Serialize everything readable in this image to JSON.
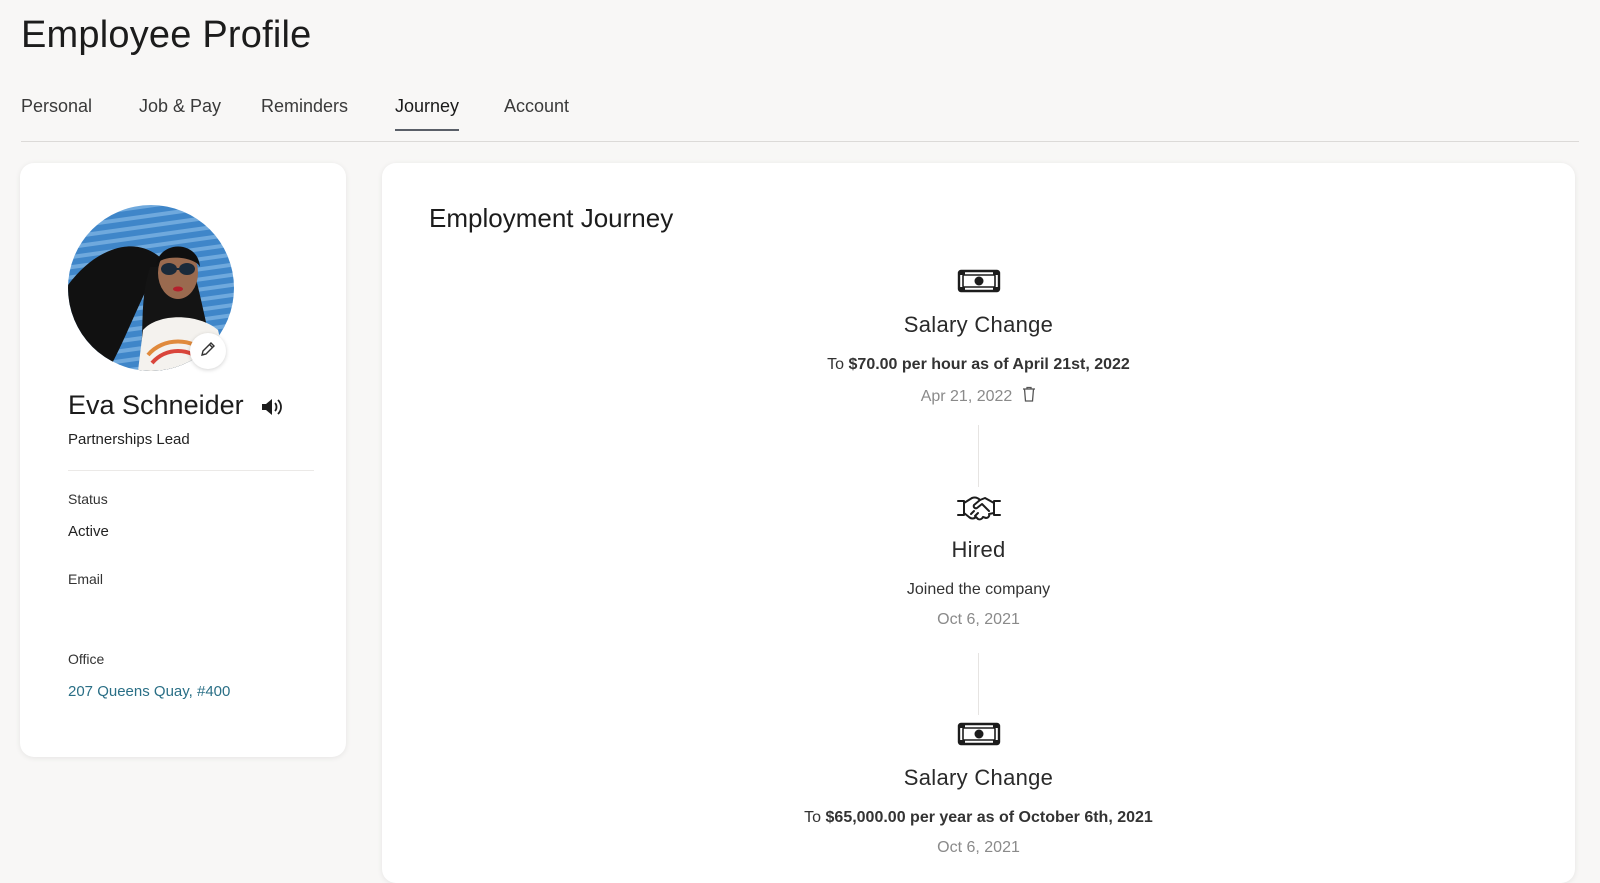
{
  "page": {
    "title": "Employee Profile"
  },
  "tabs": [
    {
      "label": "Personal"
    },
    {
      "label": "Job & Pay"
    },
    {
      "label": "Reminders"
    },
    {
      "label": "Journey",
      "active": true
    },
    {
      "label": "Account"
    }
  ],
  "profile": {
    "name": "Eva Schneider",
    "role": "Partnerships Lead",
    "status_label": "Status",
    "status_value": "Active",
    "email_label": "Email",
    "email_value": "",
    "office_label": "Office",
    "office_value": "207 Queens Quay, #400"
  },
  "journey": {
    "title": "Employment Journey",
    "events": [
      {
        "icon": "money-icon",
        "title": "Salary Change",
        "desc_prefix": "To ",
        "desc_bold": "$70.00 per hour as of April 21st, 2022",
        "date": "Apr 21, 2022",
        "deletable": true
      },
      {
        "icon": "handshake-icon",
        "title": "Hired",
        "desc_prefix": "Joined the company",
        "desc_bold": "",
        "date": "Oct 6, 2021",
        "deletable": false
      },
      {
        "icon": "money-icon",
        "title": "Salary Change",
        "desc_prefix": "To ",
        "desc_bold": "$65,000.00 per year as of October 6th, 2021",
        "date": "Oct 6, 2021",
        "deletable": false
      }
    ]
  },
  "colors": {
    "page_bg": "#f8f7f6",
    "link": "#2a6f86",
    "tab_underline": "#5a5f68"
  }
}
